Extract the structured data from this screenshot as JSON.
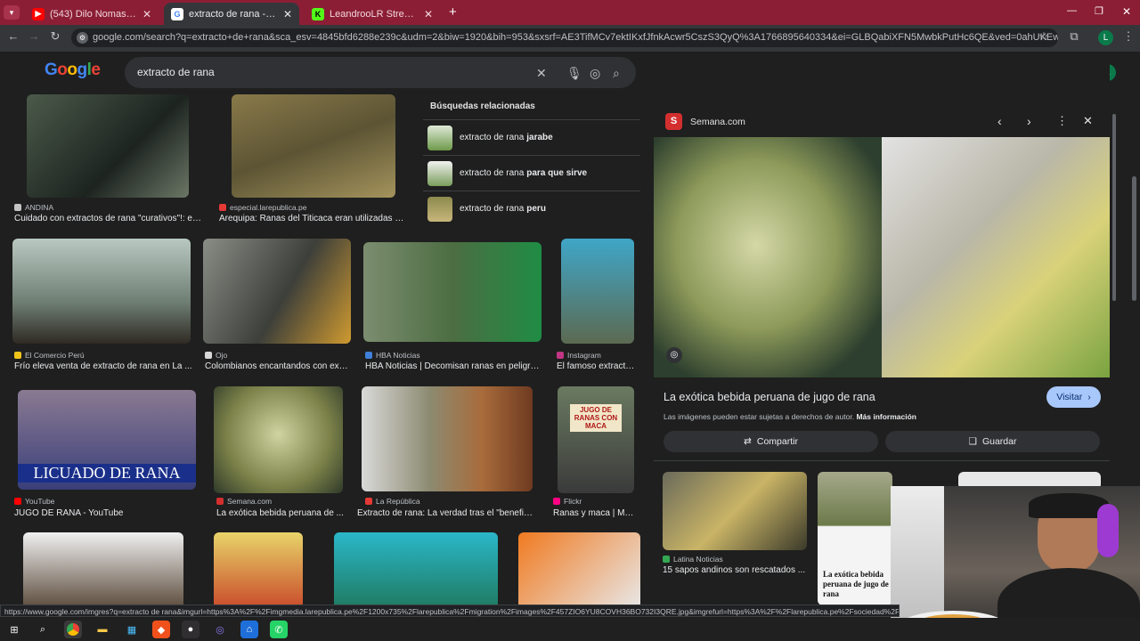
{
  "tabs": [
    {
      "title": "(543) Dilo Nomas - YouTube",
      "favicon": "youtube-icon",
      "color": "#ff0000"
    },
    {
      "title": "extracto de rana - Buscar con Google",
      "favicon": "google-icon",
      "color": "#4285f4"
    },
    {
      "title": "LeandrooLR Stream - Watch Live",
      "favicon": "kick-icon",
      "color": "#53fc18"
    }
  ],
  "address_bar": {
    "url": "google.com/search?q=extracto+de+rana&sca_esv=4845bfd6288e239c&udm=2&biw=1920&bih=953&sxsrf=AE3TifMCv7ektIKxfJfnkAcwr5CszS3QyQ%3A1766895640334&ei=GLBQabiXFN5MwbkPutHc6QE&ved=0ahUKEwi4g_2Xt9-RAxVURjABHbooNx0Q..."
  },
  "search": {
    "logo": "Google",
    "query": "extracto de rana"
  },
  "profile": {
    "initial": "L"
  },
  "related": {
    "heading": "Búsquedas relacionadas",
    "items": [
      {
        "prefix": "extracto de rana ",
        "bold": "jarabe"
      },
      {
        "prefix": "extracto de rana ",
        "bold": "para que sirve"
      },
      {
        "prefix": "extracto de rana ",
        "bold": "peru"
      }
    ]
  },
  "results": [
    {
      "source": "ANDINA",
      "caption": "Cuidado con extractos de rana \"curativos\"!: est..."
    },
    {
      "source": "especial.larepublica.pe",
      "caption": "Arequipa: Ranas del Titicaca eran utilizadas en..."
    },
    {
      "source": "El Comercio Perú",
      "caption": "Frío eleva venta de extracto de rana en La ..."
    },
    {
      "source": "Ojo",
      "caption": "Colombianos encantandos con extr..."
    },
    {
      "source": "HBA Noticias",
      "caption": "HBA Noticias | Decomisan ranas en peligro ..."
    },
    {
      "source": "Instagram",
      "caption": "El famoso extracto..."
    },
    {
      "source": "YouTube",
      "caption": "JUGO DE RANA - YouTube",
      "overlay": "LICUADO DE RANA"
    },
    {
      "source": "Semana.com",
      "caption": "La exótica bebida peruana de ..."
    },
    {
      "source": "La República",
      "caption": "Extracto de rana: La verdad tras el \"benefici..."
    },
    {
      "source": "Flickr",
      "caption": "Ranas y maca | Má...",
      "overlay": "JUGO DE RANAS CON MACA"
    }
  ],
  "panel": {
    "source": "Semana.com",
    "title": "La exótica bebida peruana de jugo de rana",
    "visit": "Visitar",
    "copyright": "Las imágenes pueden estar sujetas a derechos de autor.",
    "more_info": "Más información",
    "share": "Compartir",
    "save": "Guardar",
    "related_source": "Latina Noticias",
    "related_caption": "15 sapos andinos son rescatados ...",
    "thumb_text": "La exótica bebida peruana de jugo de rana"
  },
  "status_url": "https://www.google.com/imgres?q=extracto de rana&imgurl=https%3A%2F%2Fimgmedia.larepublica.pe%2F1200x735%2Flarepublica%2Fmigration%2Fimages%2F457ZIO6YU8COVH36BO732I3QRE.jpg&imgrefurl=https%3A%2F%2Flarepublica.pe%2Fsociedad%2F1355718-verdad-ber"
}
